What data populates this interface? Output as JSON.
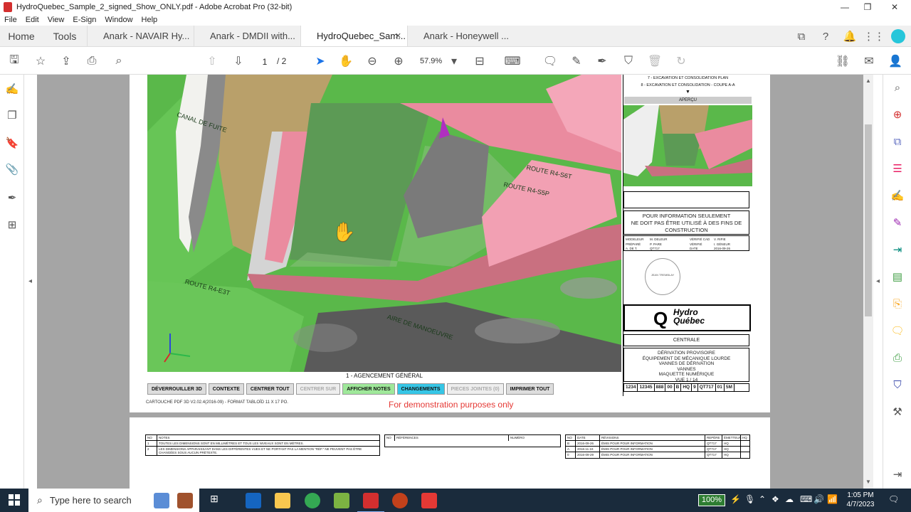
{
  "window": {
    "title": "HydroQuebec_Sample_2_signed_Show_ONLY.pdf - Adobe Acrobat Pro (32-bit)",
    "min": "—",
    "max": "❐",
    "close": "✕"
  },
  "menu": [
    "File",
    "Edit",
    "View",
    "E-Sign",
    "Window",
    "Help"
  ],
  "tabs": {
    "home": "Home",
    "tools": "Tools",
    "docs": [
      {
        "label": "Anark - NAVAIR Hy..."
      },
      {
        "label": "Anark - DMDII with..."
      },
      {
        "label": "HydroQuebec_Sam...",
        "close": "✕"
      },
      {
        "label": "Anark - Honeywell ..."
      }
    ]
  },
  "toolbar": {
    "page_current": "1",
    "page_total": "/ 2",
    "zoom": "57.9%"
  },
  "drawing": {
    "labels": {
      "canal": "CANAL DE FUITE",
      "route_s6t": "ROUTE R4-S6T",
      "route_s5p": "ROUTE R4-S5P",
      "route_e3t": "ROUTE R4-E3T",
      "aire": "AIRE DE MANOEUVRE"
    },
    "caption": "1 - AGENCEMENT GÉNÉRAL",
    "buttons": [
      {
        "label": "DÉVERROUILLER 3D",
        "style": ""
      },
      {
        "label": "CONTEXTE",
        "style": ""
      },
      {
        "label": "CENTRER TOUT",
        "style": ""
      },
      {
        "label": "CENTRER SUR",
        "style": "dis"
      },
      {
        "label": "AFFICHER NOTES",
        "style": "green"
      },
      {
        "label": "CHANGEMENTS",
        "style": "cyan"
      },
      {
        "label": "PIECES JOINTES (0)",
        "style": "dis"
      },
      {
        "label": "IMPRIMER TOUT",
        "style": ""
      }
    ],
    "footnote": "CARTOUCHE PDF 3D V2.02.4(2016-09) - FORMAT TABLOÏD 11 X 17 PO.",
    "demo": "For demonstration purposes only"
  },
  "titleblock": {
    "list7": "7 - EXCAVATION ET CONSOLIDATION PLAN",
    "list8": "8 - EXCAVATION ET CONSOLIDATION - COUPE A-A",
    "apercu": "APERÇU",
    "info_1": "POUR INFORMATION SEULEMENT",
    "info_2": "NE DOIT PAS ÊTRE UTILISÉ À DES FINS DE",
    "info_3": "CONSTRUCTION",
    "sig": {
      "modeleur": "MODELEUR",
      "modeleur_v": "M. DELEUR",
      "verifie_cad": "VÉRIFIÉ CAD",
      "verifie_cad_v": "V. RIFIE",
      "prepare": "PRÉPARÉ",
      "prepare_v": "P. PARE",
      "verifie": "VÉRIFIÉ",
      "verifie_v": "I. GÉNEUR",
      "ade": "A. DE T.",
      "ade_v": "QT717",
      "date": "DATE",
      "date_v": "2016-09-26"
    },
    "stamp": "JEAN TREMBLAY",
    "logo_q": "Q",
    "logo_1": "Hydro",
    "logo_2": "Québec",
    "centrale": "CENTRALE",
    "desc_1": "DÉRIVATION PROVISOIRE",
    "desc_2": "ÉQUIPEMENT DE MÉCANIQUE LOURDE",
    "desc_3": "VANNES DE DÉRIVATION",
    "desc_4": "VANNES",
    "desc_5": "MAQUETTE NUMÉRIQUE",
    "desc_6": "VUE 1 / 14",
    "codes": [
      "1234",
      "12345",
      "888",
      "00",
      "B",
      "HQ",
      "9",
      "QT717",
      "01",
      "5M"
    ]
  },
  "page2": {
    "notes_head": {
      "no": "NO",
      "notes": "NOTES"
    },
    "notes": [
      {
        "no": "1",
        "text": "TOUTES LES DIMENSIONS SONT EN MILLIMÈTRES ET TOUS LES NIVEAUX SONT EN MÈTRES."
      },
      {
        "no": "2",
        "text": "LES DIMENSIONS APPARAISSANT DANS LES DIFFÉRENTES VUES ET NE PORTANT PAS LA MENTION \"RÉF.\" NE PEUVENT PAS ÊTRE CHANGÉES SOUS AUCUN PRÉTEXTE."
      }
    ],
    "ref_head": {
      "no": "NO",
      "ref": "RÉFÉRENCES",
      "num": "NUMÉRO"
    },
    "rev_head": {
      "no": "NO",
      "date": "DATE",
      "rev": "RÉVISIONS",
      "repere": "REPÈRE",
      "emetteur": "ÉMETTEUR",
      "hq": "HQ"
    },
    "revisions": [
      {
        "no": "B",
        "date": "2016-09-26",
        "rev": "ÉMIS POUR POUR INFORMATION",
        "repere": "QT717",
        "emetteur": "HQ"
      },
      {
        "no": "A",
        "date": "2016-11-24",
        "rev": "ÉMIS POUR POUR INFORMATION",
        "repere": "QT717",
        "emetteur": "HQ"
      },
      {
        "no": "0",
        "date": "2016-09-29",
        "rev": "ÉMIS POUR POUR INFORMATION",
        "repere": "QT717",
        "emetteur": "HQ"
      }
    ]
  },
  "taskbar": {
    "search_placeholder": "Type here to search",
    "battery": "100%",
    "time": "1:05 PM",
    "date": "4/7/2023"
  }
}
